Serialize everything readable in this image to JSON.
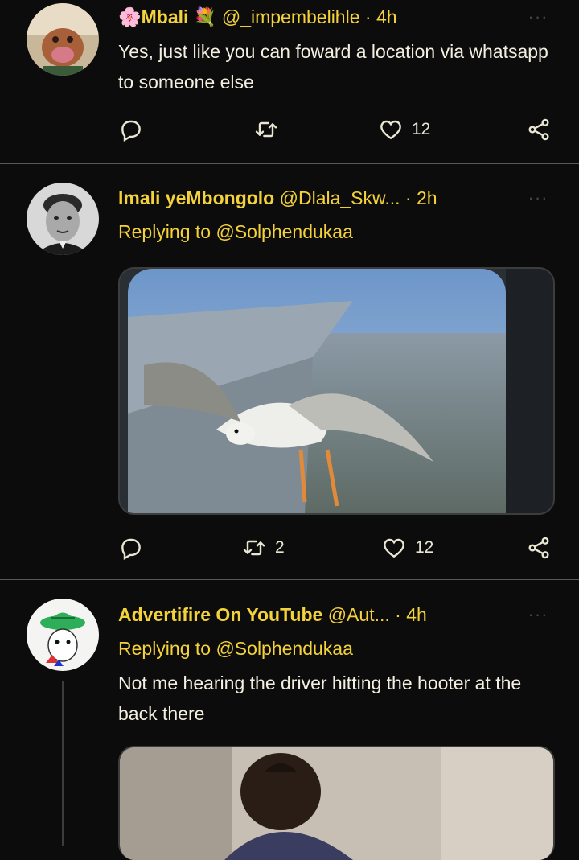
{
  "tweets": [
    {
      "name": "🌸Mbali 💐",
      "handle": "@_impembelihle",
      "dot": "·",
      "time": "4h",
      "text": "Yes, just like you can foward a location via whatsapp to someone else",
      "likes": "12",
      "retweets": ""
    },
    {
      "name": "Imali yeMbongolo",
      "handle": "@Dlala_Skw...",
      "dot": "·",
      "time": "2h",
      "reply_to": "Replying to @Solphendukaa",
      "retweets": "2",
      "likes": "12"
    },
    {
      "name": "Advertifire On YouTube",
      "handle": "@Aut...",
      "dot": "·",
      "time": "4h",
      "reply_to": "Replying to @Solphendukaa",
      "text": "Not me hearing the driver hitting the hooter at the back there"
    }
  ],
  "colors": {
    "accent": "#f4d23a",
    "background": "#0c0c0c",
    "text": "#f3f0e2"
  },
  "icons": [
    "reply-icon",
    "retweet-icon",
    "like-icon",
    "share-icon",
    "more-icon"
  ]
}
